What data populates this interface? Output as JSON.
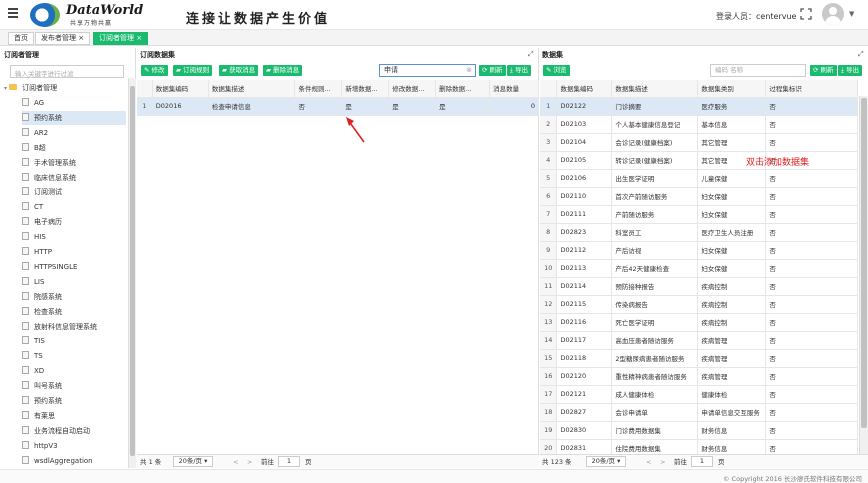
{
  "header": {
    "logo_title": "DataWorld",
    "logo_subtitle": "共享万物共赢",
    "slogan": "连接让数据产生价值",
    "login_label": "登录人员：centervue"
  },
  "tabs": [
    {
      "label": "首页"
    },
    {
      "label": "发布者管理 ×"
    },
    {
      "label": "订阅者管理 ×"
    }
  ],
  "left": {
    "title": "订阅者管理",
    "search_placeholder": "输入关键字进行过滤",
    "root": "订阅者管理",
    "items": [
      "AG",
      "预约系统",
      "AR2",
      "B超",
      "手术管理系统",
      "临床信息系统",
      "订阅测试",
      "CT",
      "电子病历",
      "HIS",
      "HTTP",
      "HTTPSINGLE",
      "LIS",
      "院感系统",
      "检查系统",
      "放射科信息管理系统",
      "TIS",
      "TS",
      "XD",
      "叫号系统",
      "预约系统",
      "有莱思",
      "业务流程自动启动",
      "httpV3",
      "wsdlAggregation"
    ]
  },
  "mid": {
    "title": "订阅数据集",
    "buttons": [
      "修改",
      "订阅规则",
      "获取消息",
      "删除消息"
    ],
    "search_value": "申请",
    "refresh": "刷新",
    "export": "导出",
    "columns": [
      "数据集编码",
      "数据集描述",
      "条件规则...",
      "新增数据...",
      "修改数据...",
      "删除数据...",
      "消息数量"
    ],
    "rows": [
      {
        "n": "1",
        "code": "D02016",
        "desc": "检查申请信息",
        "cond": "否",
        "add": "是",
        "mod": "是",
        "del": "是",
        "msg": "0"
      }
    ],
    "footer_total": "共 1 条",
    "page_size": "20条/页",
    "goto": "前往",
    "page": "1",
    "page_unit": "页"
  },
  "right": {
    "title": "数据集",
    "browse": "浏览",
    "search_placeholder": "编码 名称",
    "refresh": "刷新",
    "export": "导出",
    "columns": [
      "数据集编码",
      "数据集描述",
      "数据集类别",
      "过程集标识"
    ],
    "annotation": "双击添加数据集",
    "rows": [
      {
        "n": "1",
        "code": "D02122",
        "desc": "门诊摘要",
        "cat": "医疗服务",
        "flag": "否"
      },
      {
        "n": "2",
        "code": "D02103",
        "desc": "个人基本健康信息登记",
        "cat": "基本信息",
        "flag": "否"
      },
      {
        "n": "3",
        "code": "D02104",
        "desc": "会诊记录(健康档案)",
        "cat": "其它管理",
        "flag": "否"
      },
      {
        "n": "4",
        "code": "D02105",
        "desc": "转诊记录(健康档案)",
        "cat": "其它管理",
        "flag": "否"
      },
      {
        "n": "5",
        "code": "D02106",
        "desc": "出生医学证明",
        "cat": "儿童保健",
        "flag": "否"
      },
      {
        "n": "6",
        "code": "D02110",
        "desc": "首次产前随访服务",
        "cat": "妇女保健",
        "flag": "否"
      },
      {
        "n": "7",
        "code": "D02111",
        "desc": "产前随访服务",
        "cat": "妇女保健",
        "flag": "否"
      },
      {
        "n": "8",
        "code": "D02823",
        "desc": "科室员工",
        "cat": "医疗卫生人员注册",
        "flag": "否"
      },
      {
        "n": "9",
        "code": "D02112",
        "desc": "产后访视",
        "cat": "妇女保健",
        "flag": "否"
      },
      {
        "n": "10",
        "code": "D02113",
        "desc": "产后42天健康检查",
        "cat": "妇女保健",
        "flag": "否"
      },
      {
        "n": "11",
        "code": "D02114",
        "desc": "预防接种报告",
        "cat": "疾病控制",
        "flag": "否"
      },
      {
        "n": "12",
        "code": "D02115",
        "desc": "传染病报告",
        "cat": "疾病控制",
        "flag": "否"
      },
      {
        "n": "13",
        "code": "D02116",
        "desc": "死亡医学证明",
        "cat": "疾病控制",
        "flag": "否"
      },
      {
        "n": "14",
        "code": "D02117",
        "desc": "高血压患者随访服务",
        "cat": "疾病管理",
        "flag": "否"
      },
      {
        "n": "15",
        "code": "D02118",
        "desc": "2型糖尿病患者随访服务",
        "cat": "疾病管理",
        "flag": "否"
      },
      {
        "n": "16",
        "code": "D02120",
        "desc": "重性精神病患者随访服务",
        "cat": "疾病管理",
        "flag": "否"
      },
      {
        "n": "17",
        "code": "D02121",
        "desc": "成人健康体检",
        "cat": "健康体检",
        "flag": "否"
      },
      {
        "n": "18",
        "code": "D02827",
        "desc": "会诊申请单",
        "cat": "申请单信息交互服务",
        "flag": "否"
      },
      {
        "n": "19",
        "code": "D02830",
        "desc": "门诊费用数据集",
        "cat": "财务信息",
        "flag": "否"
      },
      {
        "n": "20",
        "code": "D02831",
        "desc": "住院费用数据集",
        "cat": "财务信息",
        "flag": "否"
      }
    ],
    "footer_total": "共 123 条",
    "page_size": "20条/页",
    "goto": "前往",
    "page": "1",
    "page_unit": "页"
  },
  "copyright": "© Copyright 2016 长沙廖氏软件科技有限公司",
  "colors": {
    "accent": "#1aba6f",
    "selected": "#dce8f5",
    "annotation": "#e02020"
  }
}
